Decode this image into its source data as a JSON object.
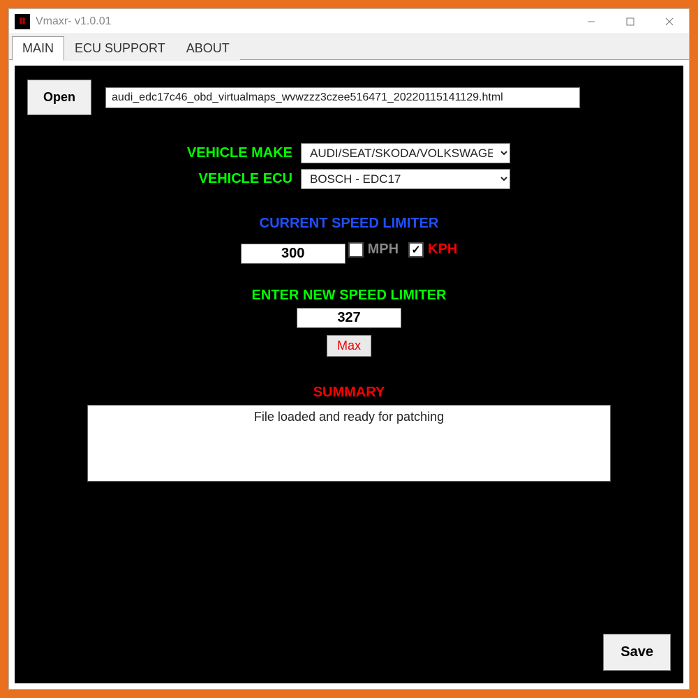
{
  "window": {
    "title": "Vmaxr- v1.0.01"
  },
  "tabs": {
    "main": "MAIN",
    "ecu_support": "ECU SUPPORT",
    "about": "ABOUT"
  },
  "buttons": {
    "open": "Open",
    "max": "Max",
    "save": "Save"
  },
  "file": {
    "path": "audi_edc17c46_obd_virtualmaps_wvwzzz3czee516471_20220115141129.html"
  },
  "form": {
    "vehicle_make_label": "VEHICLE MAKE",
    "vehicle_make_value": "AUDI/SEAT/SKODA/VOLKSWAGEN",
    "vehicle_ecu_label": "VEHICLE ECU",
    "vehicle_ecu_value": "BOSCH - EDC17"
  },
  "current": {
    "header": "CURRENT SPEED LIMITER",
    "value": "300",
    "mph_label": "MPH",
    "kph_label": "KPH",
    "mph_checked": false,
    "kph_checked": true
  },
  "new": {
    "header": "ENTER NEW SPEED LIMITER",
    "value": "327"
  },
  "summary": {
    "header": "SUMMARY",
    "text": "File loaded and ready for patching"
  }
}
